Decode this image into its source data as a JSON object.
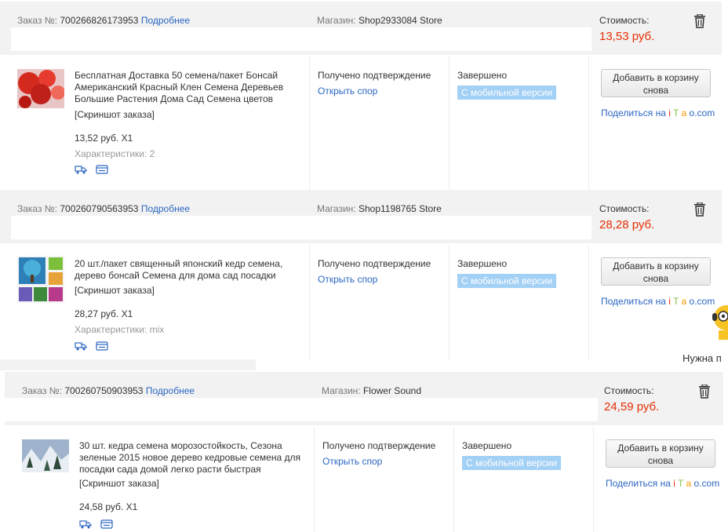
{
  "labels": {
    "order_no": "Заказ №:",
    "more": "Подробнее",
    "shop": "Магазин:",
    "cost": "Стоимость:",
    "screenshot": "[Скриншот заказа]",
    "status_confirmed": "Получено подтверждение",
    "open_dispute": "Открыть спор",
    "status_completed": "Завершено",
    "mobile_badge": "С мобильной версии",
    "add_to_cart_line1": "Добавить в корзину",
    "add_to_cart_line2": "снова",
    "share_prefix": "Поделиться на ",
    "share_i": "i",
    "share_t": "T",
    "share_a": "a",
    "share_o": "o.com"
  },
  "help_text": "Нужна п",
  "orders": [
    {
      "number": "700266826173953",
      "shop": "Shop2933084 Store",
      "cost": "13,53 руб.",
      "title": "Бесплатная Доставка 50 семена/пакет Бонсай Американский Красный Клен Семена Деревьев Большие Растения Дома Сад Семена цветов",
      "price": "13,52 руб. X1",
      "characteristics": "Характеристики: 2"
    },
    {
      "number": "700260790563953",
      "shop": "Shop1198765 Store",
      "cost": "28,28 руб.",
      "title": "20 шт./пакет священный японский кедр семена, дерево бонсай Семена для дома сад посадки",
      "price": "28,27 руб. X1",
      "characteristics": "Характеристики: mix"
    },
    {
      "number": "700260750903953",
      "shop": "Flower Sound",
      "cost": "24,59 руб.",
      "title": "30 шт. кедра семена морозостойкость, Сезона зеленые 2015 новое дерево кедровые семена для посадки сада домой легко расти быстрая",
      "price": "24,58 руб. X1",
      "characteristics": ""
    }
  ],
  "colors": {
    "accent_red": "#e62e04",
    "link_blue": "#2b66c2",
    "badge_blue": "#a3d0f5"
  }
}
